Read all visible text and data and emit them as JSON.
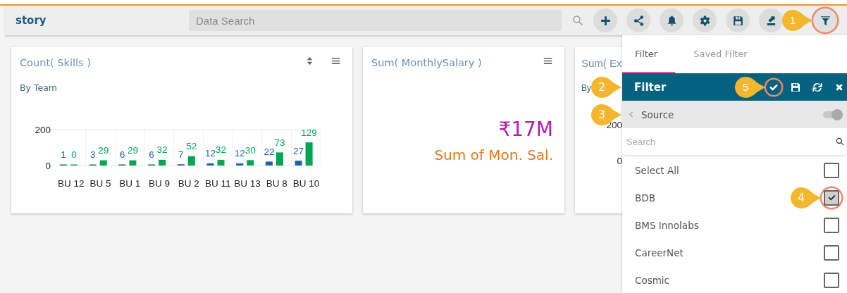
{
  "header": {
    "title": "story",
    "search": {
      "placeholder": "Data Search"
    },
    "tools": [
      {
        "kind": "plus",
        "highlighted": false
      },
      {
        "kind": "share",
        "highlighted": false
      },
      {
        "kind": "bell",
        "highlighted": false
      },
      {
        "kind": "gear",
        "highlighted": false
      },
      {
        "kind": "save",
        "highlighted": false
      },
      {
        "kind": "export",
        "highlighted": false
      },
      {
        "kind": "filter",
        "highlighted": true,
        "callout": "1"
      }
    ]
  },
  "cards": [
    {
      "kind": "chart",
      "title": "Count( Skills )",
      "subtitle": "By Team",
      "chart_data": {
        "type": "bar",
        "categories": [
          "BU 12",
          "BU 5",
          "BU 1",
          "BU 9",
          "BU 2",
          "BU 11",
          "BU 13",
          "BU 8",
          "BU 10"
        ],
        "series": [
          {
            "color": "#1f5fb0",
            "values": [
              1,
              3,
              6,
              6,
              7,
              12,
              12,
              22,
              27
            ]
          },
          {
            "color": "#00a651",
            "values": [
              0,
              29,
              29,
              32,
              52,
              32,
              30,
              73,
              129
            ]
          }
        ],
        "ylim": [
          0,
          200
        ],
        "yticks": [
          0,
          200
        ],
        "data_labels": true
      }
    },
    {
      "kind": "kpi",
      "title": "Sum( MonthlySalary )",
      "value": "₹17M",
      "caption": "Sum of Mon. Sal."
    },
    {
      "kind": "partial",
      "title": "Sum( Ex",
      "subtitle": "By",
      "axis_labels": [
        "200",
        "0"
      ]
    }
  ],
  "filter_panel": {
    "tabs": [
      {
        "label": "Filter",
        "selected": true
      },
      {
        "label": "Saved Filter",
        "selected": false
      }
    ],
    "header": {
      "title": "Filter",
      "callout": "2",
      "actions": [
        {
          "kind": "check",
          "highlighted": true,
          "callout": "5"
        },
        {
          "kind": "save",
          "highlighted": false
        },
        {
          "kind": "refresh",
          "highlighted": false
        },
        {
          "kind": "close",
          "highlighted": false
        }
      ]
    },
    "source": {
      "label": "Source",
      "toggle_on": false,
      "callout": "3"
    },
    "search": {
      "placeholder": "Search"
    },
    "items": [
      {
        "label": "Select All",
        "checked": false,
        "highlighted": false
      },
      {
        "label": "BDB",
        "checked": true,
        "highlighted": true,
        "callout": "4"
      },
      {
        "label": "BMS Innolabs",
        "checked": false,
        "highlighted": false
      },
      {
        "label": "CareerNet",
        "checked": false,
        "highlighted": false
      },
      {
        "label": "Cosmic",
        "checked": false,
        "highlighted": false
      }
    ]
  }
}
